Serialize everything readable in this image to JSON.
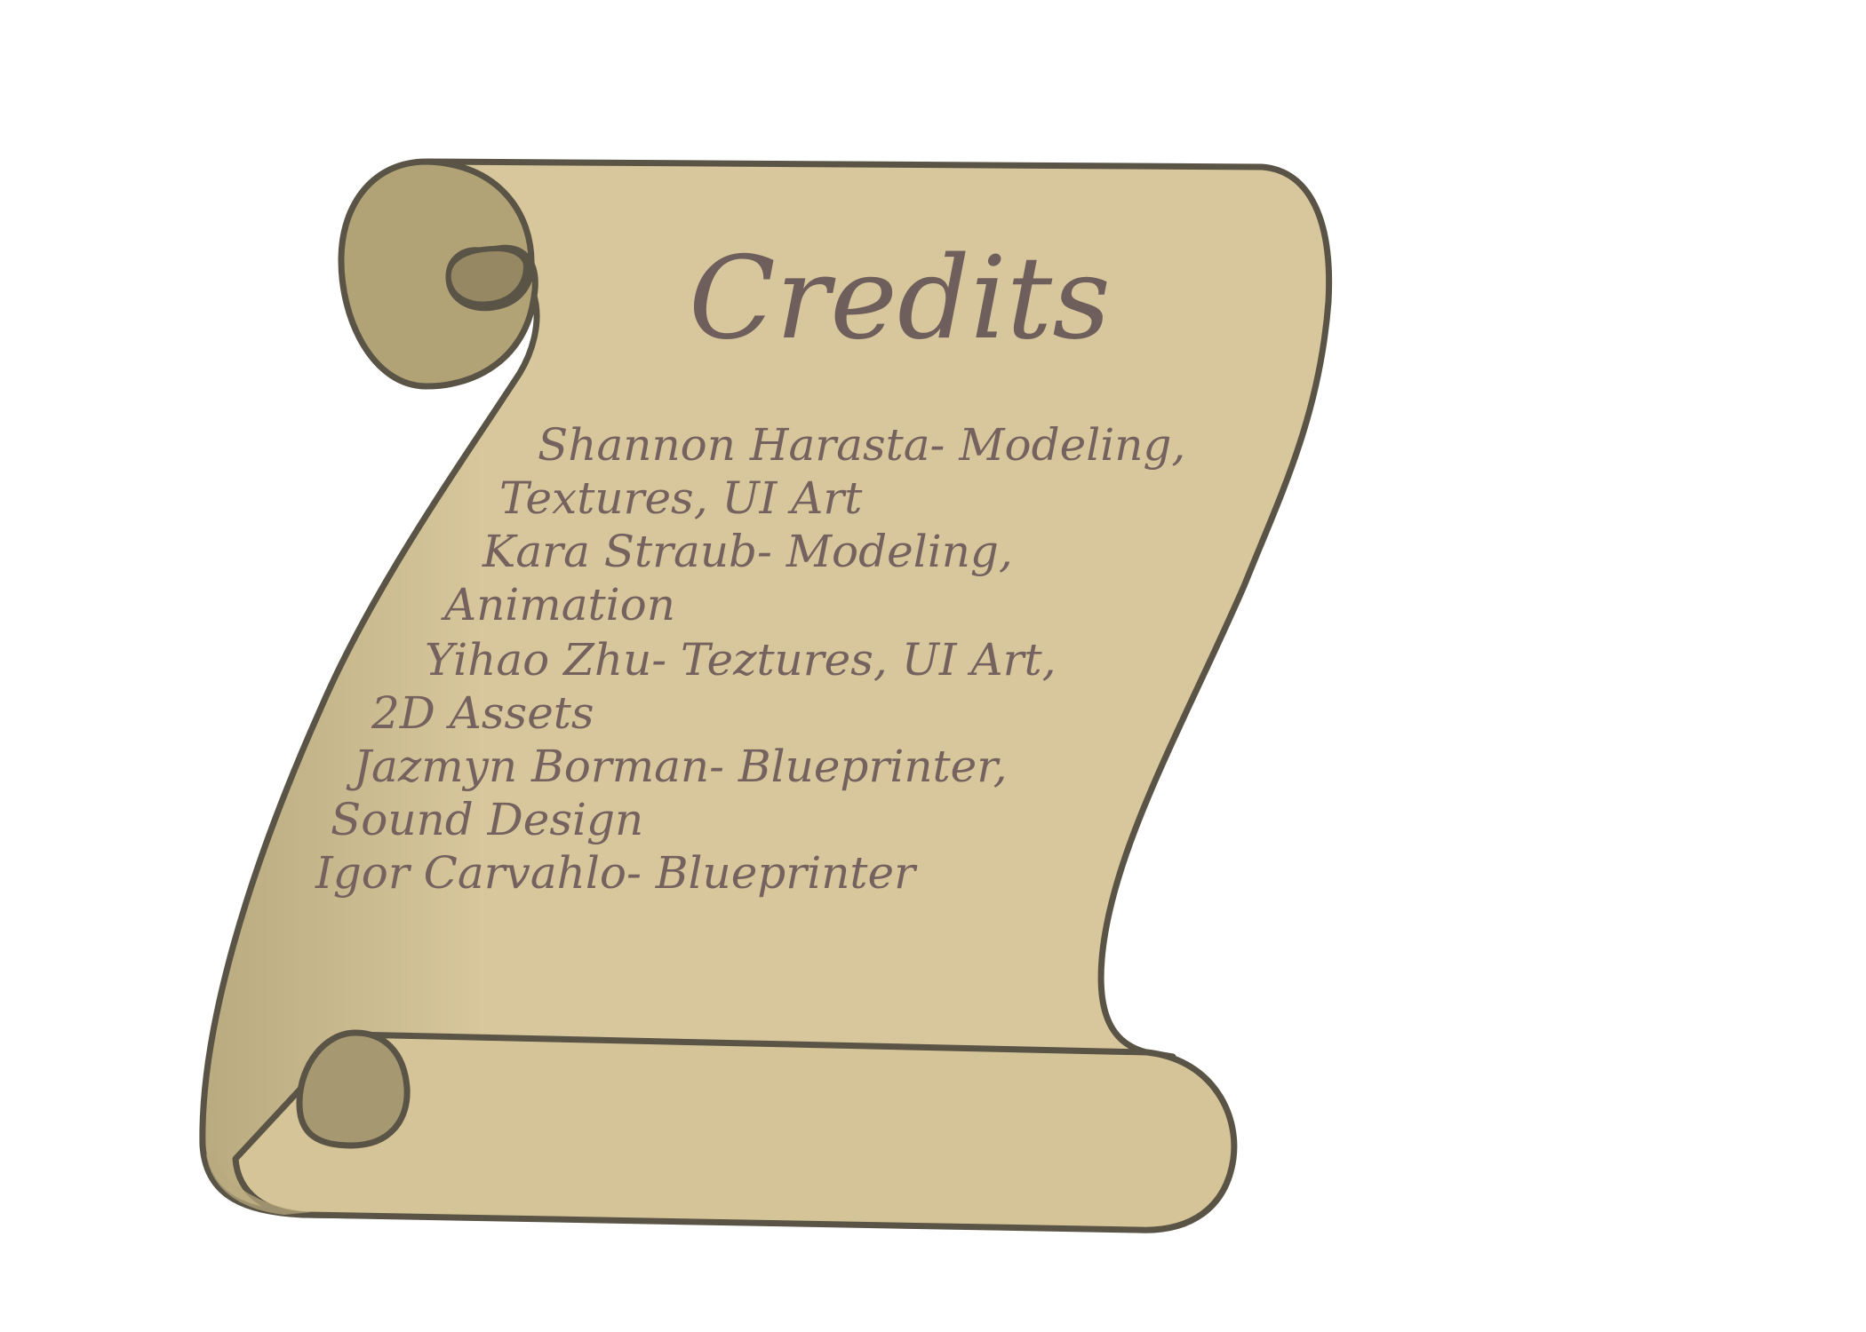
{
  "screen": {
    "title": "Credits",
    "lines": [
      "Shannon Harasta- Modeling,",
      "Textures, UI Art",
      "Kara Straub- Modeling,",
      "Animation",
      "Yihao Zhu- Teztures, UI Art,",
      "2D Assets",
      "Jazmyn Borman- Blueprinter,",
      "Sound Design",
      "Igor Carvahlo- Blueprinter"
    ]
  },
  "colors": {
    "parchment": "#d8c79c",
    "parchment_shadow": "#b9aa7f",
    "curl_inner": "#a89a70",
    "outline": "#5a5446",
    "text": "#75625f",
    "background": "#ffffff"
  },
  "icons": {
    "scroll": "parchment-scroll-icon"
  }
}
